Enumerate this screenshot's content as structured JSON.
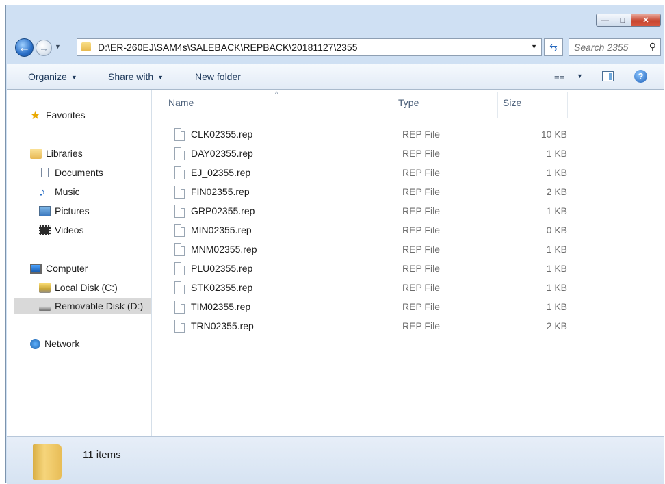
{
  "address": {
    "path": "D:\\ER-260EJ\\SAM4s\\SALEBACK\\REPBACK\\20181127\\2355"
  },
  "search": {
    "placeholder": "Search 2355"
  },
  "toolbar": {
    "organize": "Organize",
    "share_with": "Share with",
    "new_folder": "New folder"
  },
  "nav": {
    "favorites": "Favorites",
    "libraries": "Libraries",
    "documents": "Documents",
    "music": "Music",
    "pictures": "Pictures",
    "videos": "Videos",
    "computer": "Computer",
    "local_disk": "Local Disk (C:)",
    "removable_disk": "Removable Disk (D:)",
    "network": "Network"
  },
  "columns": {
    "name": "Name",
    "type": "Type",
    "size": "Size"
  },
  "files": [
    {
      "name": "CLK02355.rep",
      "type": "REP File",
      "size": "10 KB"
    },
    {
      "name": "DAY02355.rep",
      "type": "REP File",
      "size": "1 KB"
    },
    {
      "name": "EJ_02355.rep",
      "type": "REP File",
      "size": "1 KB"
    },
    {
      "name": "FIN02355.rep",
      "type": "REP File",
      "size": "2 KB"
    },
    {
      "name": "GRP02355.rep",
      "type": "REP File",
      "size": "1 KB"
    },
    {
      "name": "MIN02355.rep",
      "type": "REP File",
      "size": "0 KB"
    },
    {
      "name": "MNM02355.rep",
      "type": "REP File",
      "size": "1 KB"
    },
    {
      "name": "PLU02355.rep",
      "type": "REP File",
      "size": "1 KB"
    },
    {
      "name": "STK02355.rep",
      "type": "REP File",
      "size": "1 KB"
    },
    {
      "name": "TIM02355.rep",
      "type": "REP File",
      "size": "1 KB"
    },
    {
      "name": "TRN02355.rep",
      "type": "REP File",
      "size": "2 KB"
    }
  ],
  "status": {
    "count": "11 items"
  }
}
